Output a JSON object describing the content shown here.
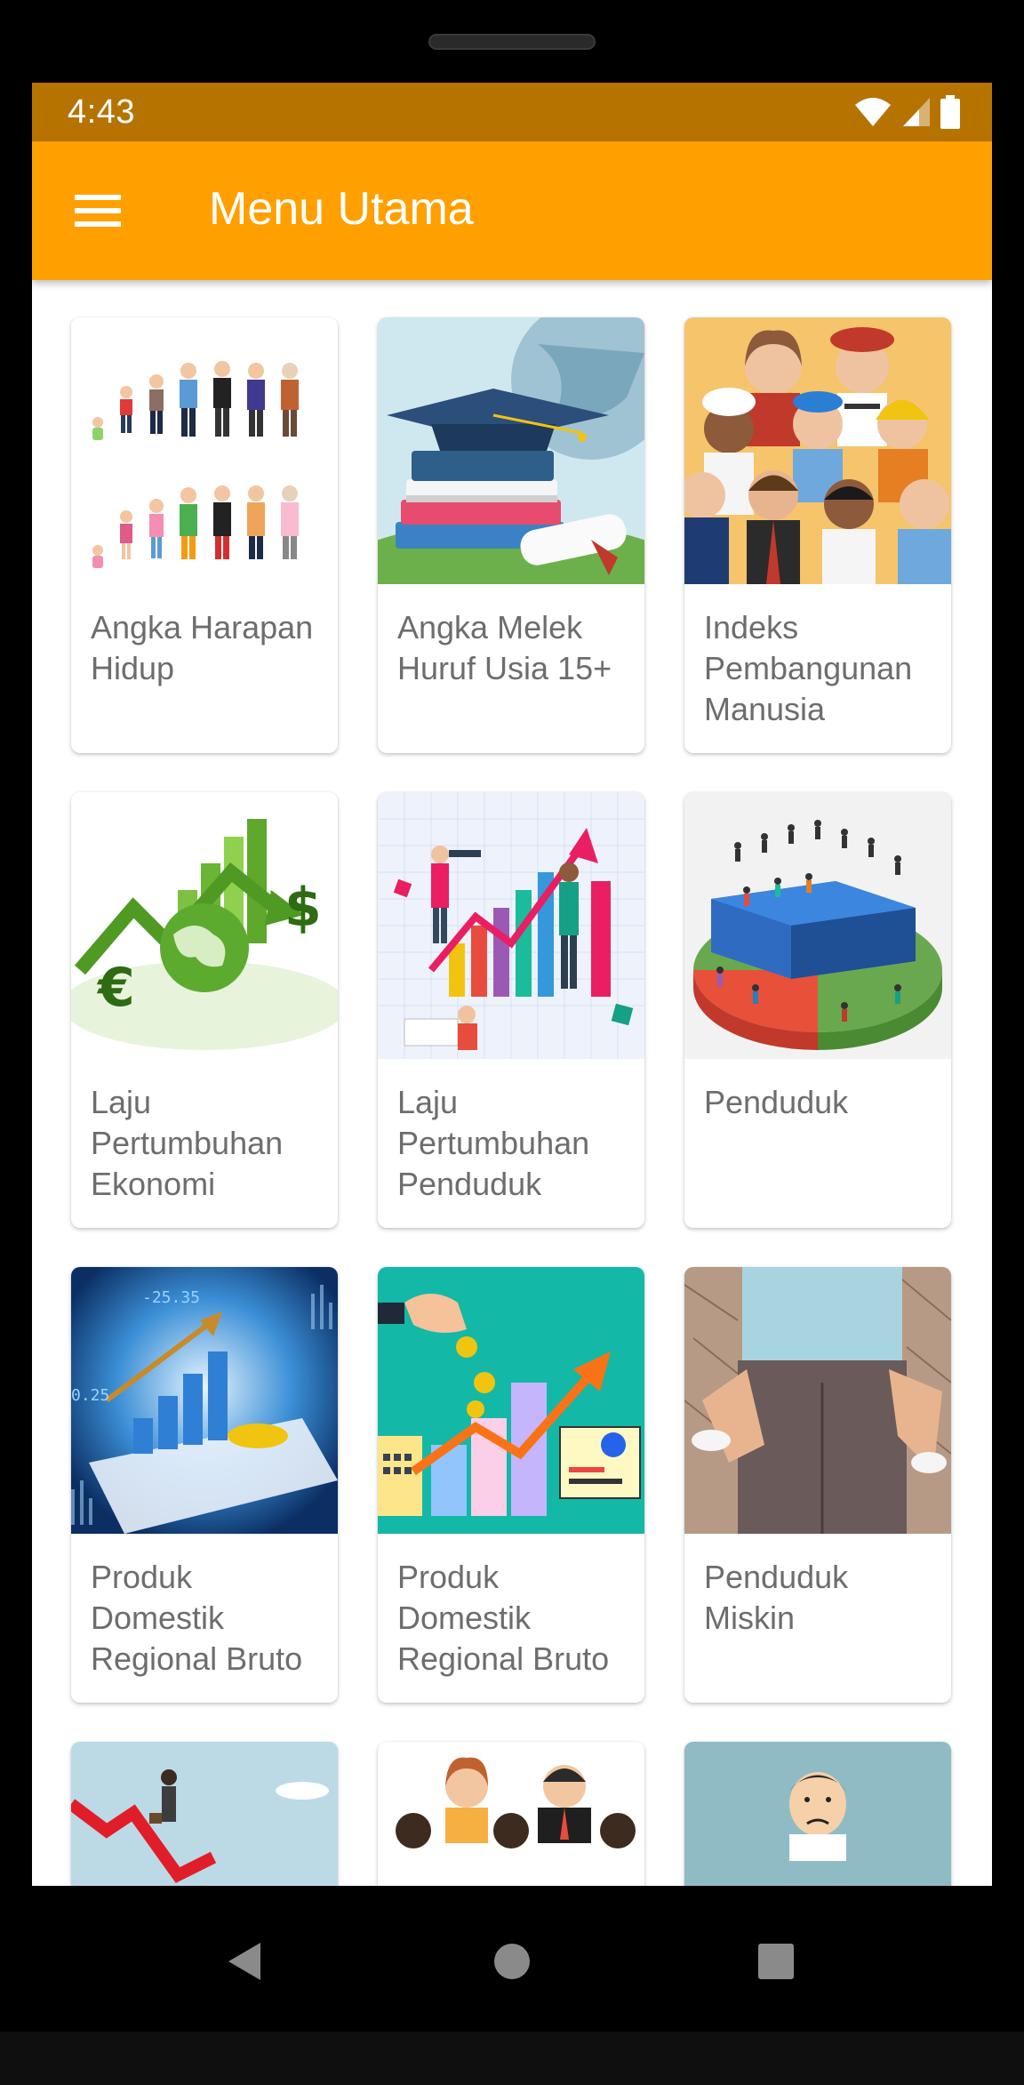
{
  "status": {
    "time": "4:43"
  },
  "app_bar": {
    "title": "Menu Utama"
  },
  "icons": {
    "menu": "menu-icon",
    "wifi": "wifi-icon",
    "signal": "signal-icon",
    "battery": "battery-icon"
  },
  "colors": {
    "app_bar": "#FFA000",
    "status_bar": "#B77300",
    "card_text": "#6d6d6d"
  },
  "menu_items": [
    {
      "label": "Angka Harapan Hidup"
    },
    {
      "label": "Angka Melek Huruf Usia 15+"
    },
    {
      "label": "Indeks Pembangunan Manusia"
    },
    {
      "label": "Laju Pertumbuhan Ekonomi"
    },
    {
      "label": "Laju Pertumbuhan Penduduk"
    },
    {
      "label": "Penduduk"
    },
    {
      "label": "Produk Domestik Regional Bruto"
    },
    {
      "label": "Produk Domestik Regional Bruto"
    },
    {
      "label": "Penduduk Miskin"
    }
  ]
}
